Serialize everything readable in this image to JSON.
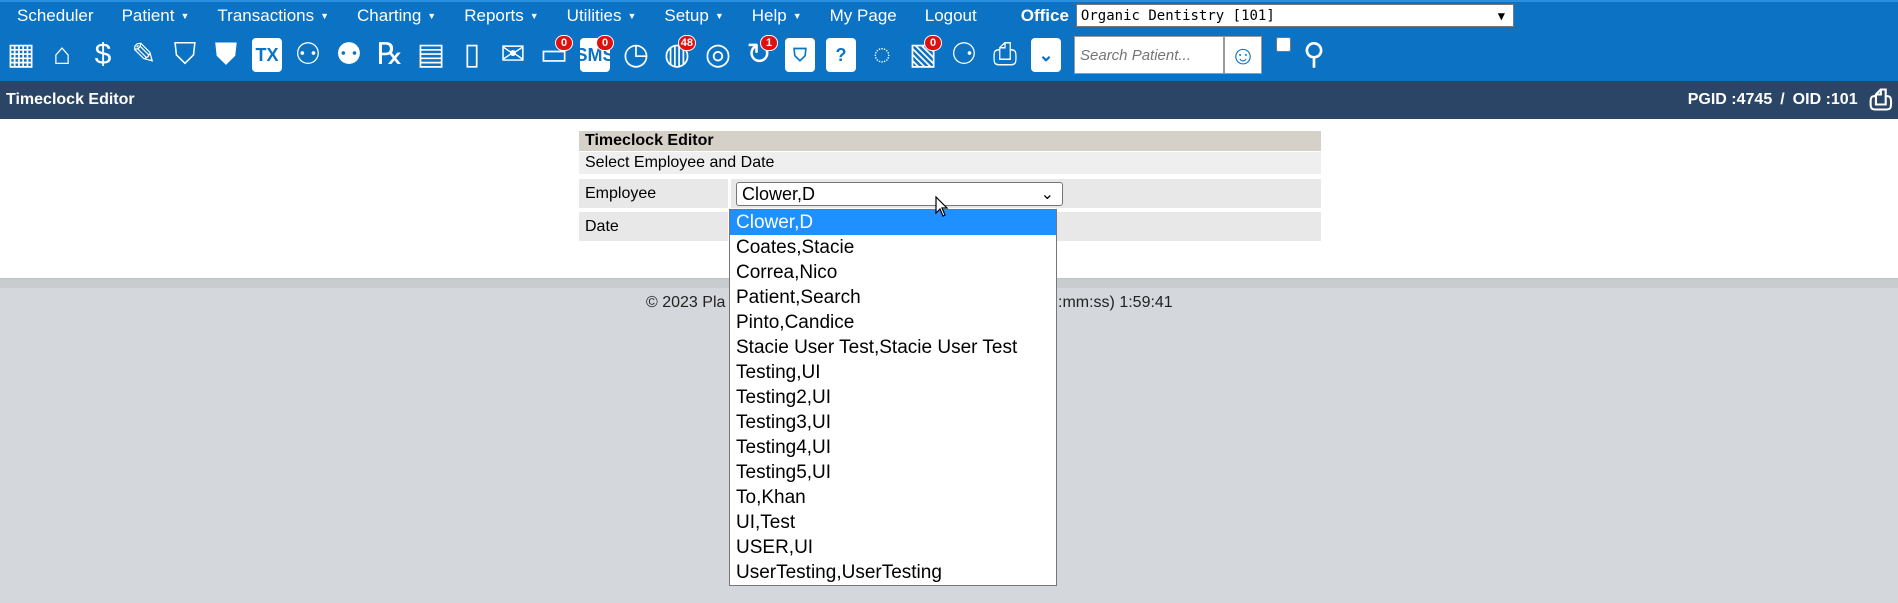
{
  "menu": {
    "items": [
      {
        "label": "Scheduler",
        "caret": false
      },
      {
        "label": "Patient",
        "caret": true
      },
      {
        "label": "Transactions",
        "caret": true
      },
      {
        "label": "Charting",
        "caret": true
      },
      {
        "label": "Reports",
        "caret": true
      },
      {
        "label": "Utilities",
        "caret": true
      },
      {
        "label": "Setup",
        "caret": true
      },
      {
        "label": "Help",
        "caret": true
      },
      {
        "label": "My Page",
        "caret": false
      },
      {
        "label": "Logout",
        "caret": false
      }
    ],
    "caret_glyph": "▼",
    "office_label": "Office",
    "office_value": "Organic Dentistry [101]"
  },
  "toolbar": {
    "icons": [
      {
        "name": "calendar-icon",
        "glyph": "▦"
      },
      {
        "name": "home-icon",
        "glyph": "⌂"
      },
      {
        "name": "dollar-icon",
        "glyph": "$"
      },
      {
        "name": "edit-note-icon",
        "glyph": "✎"
      },
      {
        "name": "tooth-icon",
        "glyph": "⛉"
      },
      {
        "name": "tooth-roots-icon",
        "glyph": "⛊"
      },
      {
        "name": "tx-icon",
        "glyph": "TX",
        "boxed": true
      },
      {
        "name": "add-user-icon",
        "glyph": "⚇"
      },
      {
        "name": "add-users-icon",
        "glyph": "⚉"
      },
      {
        "name": "rx-icon",
        "glyph": "℞"
      },
      {
        "name": "message-icon",
        "glyph": "▤"
      },
      {
        "name": "document-icon",
        "glyph": "▯"
      },
      {
        "name": "mail-icon",
        "glyph": "✉"
      },
      {
        "name": "chat-icon",
        "glyph": "▭",
        "badge": "0"
      },
      {
        "name": "sms-icon",
        "glyph": "SMS",
        "boxed": true,
        "badge": "0"
      },
      {
        "name": "clock-icon",
        "glyph": "◷"
      },
      {
        "name": "globe-users-icon",
        "glyph": "◍",
        "badge": "48"
      },
      {
        "name": "globe-user-icon",
        "glyph": "◎"
      },
      {
        "name": "user-refresh-icon",
        "glyph": "↻",
        "badge": "1"
      },
      {
        "name": "tooth-box-icon",
        "glyph": "⛉",
        "boxed": true
      },
      {
        "name": "help-tooth-icon",
        "glyph": "?",
        "boxed": true
      },
      {
        "name": "globe-pointer-icon",
        "glyph": "◌"
      },
      {
        "name": "document-check-icon",
        "glyph": "▧",
        "badge": "0"
      },
      {
        "name": "family-icon",
        "glyph": "⚆"
      },
      {
        "name": "printer-icon",
        "glyph": "⎙"
      },
      {
        "name": "chevrons-down-icon",
        "glyph": "⌄",
        "boxed": true
      }
    ],
    "search_placeholder": "Search Patient...",
    "search_user_glyph": "☺",
    "search_group_glyph": "⚲"
  },
  "header": {
    "title": "Timeclock Editor",
    "pgid": "PGID :4745",
    "separator": "/",
    "oid": "OID :101",
    "print_glyph": "⎙"
  },
  "panel": {
    "title": "Timeclock Editor",
    "subtitle": "Select Employee and Date",
    "employee_label": "Employee",
    "employee_value": "Clower,D",
    "date_label": "Date"
  },
  "footer": {
    "left": "© 2023 Pla",
    "right": ":mm:ss) 1:59:41"
  },
  "dropdown": {
    "options": [
      "Clower,D",
      "Coates,Stacie",
      "Correa,Nico",
      "Patient,Search",
      "Pinto,Candice",
      "Stacie User Test,Stacie User Test",
      "Testing,UI",
      "Testing2,UI",
      "Testing3,UI",
      "Testing4,UI",
      "Testing5,UI",
      "To,Khan",
      "UI,Test",
      "USER,UI",
      "UserTesting,UserTesting"
    ],
    "selected_index": 0
  },
  "colors": {
    "menu_bg": "#0b72c4",
    "header_bg": "#2b4566",
    "selected_option": "#1e90ff",
    "badge": "#e01010"
  }
}
